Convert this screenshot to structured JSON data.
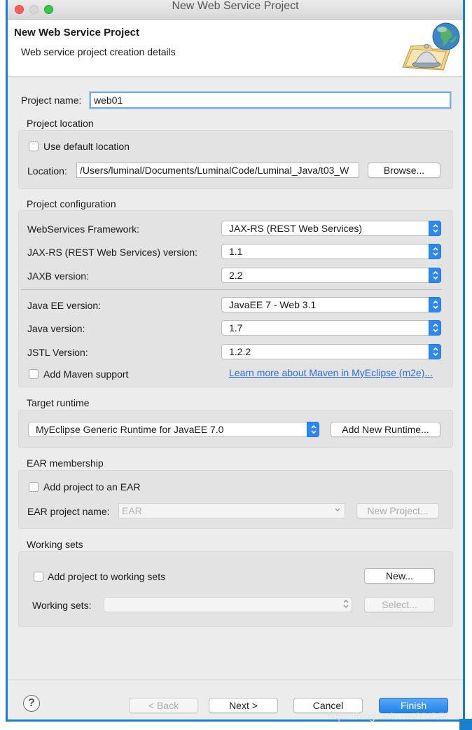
{
  "window": {
    "title": "New Web Service Project"
  },
  "banner": {
    "title": "New Web Service Project",
    "subtitle": "Web service project creation details",
    "icon": "web-service-globe-bell-icon"
  },
  "project": {
    "name_label": "Project name:",
    "name_value": "web01"
  },
  "location": {
    "section_label": "Project location",
    "use_default_label": "Use default location",
    "use_default_checked": false,
    "location_label": "Location:",
    "location_value": "/Users/luminal/Documents/LuminalCode/Luminal_Java/t03_W",
    "browse_label": "Browse..."
  },
  "config": {
    "section_label": "Project configuration",
    "framework_label": "WebServices Framework:",
    "framework_value": "JAX-RS (REST Web Services)",
    "jaxrs_label": "JAX-RS (REST Web Services) version:",
    "jaxrs_value": "1.1",
    "jaxb_label": "JAXB version:",
    "jaxb_value": "2.2",
    "javaee_label": "Java EE version:",
    "javaee_value": "JavaEE 7 - Web 3.1",
    "java_label": "Java version:",
    "java_value": "1.7",
    "jstl_label": "JSTL Version:",
    "jstl_value": "1.2.2",
    "maven_label": "Add Maven support",
    "maven_checked": false,
    "maven_link": "Learn more about Maven in MyEclipse (m2e)..."
  },
  "runtime": {
    "section_label": "Target runtime",
    "value": "MyEclipse Generic Runtime for JavaEE 7.0",
    "add_button": "Add New Runtime..."
  },
  "ear": {
    "section_label": "EAR membership",
    "add_label": "Add project to an EAR",
    "add_checked": false,
    "name_label": "EAR project name:",
    "name_value": "EAR",
    "new_project_button": "New Project..."
  },
  "working_sets": {
    "section_label": "Working sets",
    "add_label": "Add project to working sets",
    "add_checked": false,
    "new_button": "New...",
    "sets_label": "Working sets:",
    "sets_value": "",
    "select_button": "Select..."
  },
  "footer": {
    "help_symbol": "?",
    "back_button": "< Back",
    "next_button": "Next >",
    "cancel_button": "Cancel",
    "finish_button": "Finish",
    "watermark": "https://blog.csdn.net/YUDFL"
  },
  "colors": {
    "accent": "#1f84ea",
    "window_border": "#1b7fcf",
    "link": "#2a6fd6"
  }
}
